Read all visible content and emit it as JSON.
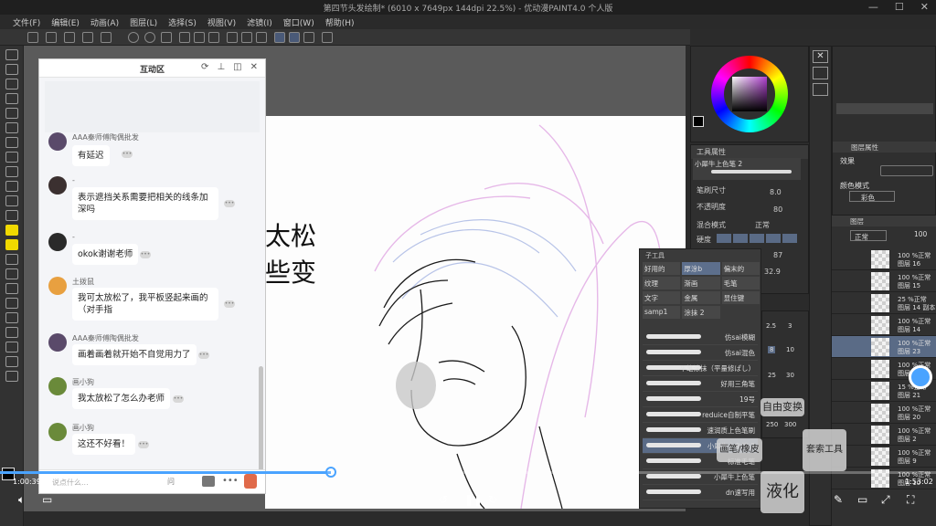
{
  "window": {
    "title": "第四节头发绘制* (6010 x 7649px 144dpi 22.5%) - 优动漫PAINT4.0 个人版",
    "controls": [
      "—",
      "☐",
      "✕"
    ]
  },
  "menu": [
    "文件(F)",
    "编辑(E)",
    "动画(A)",
    "图层(L)",
    "选择(S)",
    "视图(V)",
    "滤镜(I)",
    "窗口(W)",
    "帮助(H)"
  ],
  "chat": {
    "title": "互动区",
    "icons": [
      "⟳",
      "⊥",
      "◫",
      "✕"
    ],
    "input_placeholder": "说点什么...",
    "ask_label": "问",
    "messages": [
      {
        "user": "AAA秦师傅陶偶批发",
        "text": "有延迟",
        "avatar_color": "#5a4a6a"
      },
      {
        "user": "-",
        "text": "表示遮挡关系需要把相关的线条加深吗",
        "avatar_color": "#3b3030"
      },
      {
        "user": "-",
        "text": "okok谢谢老师",
        "avatar_color": "#2a2a2a"
      },
      {
        "user": "土拨鼠",
        "text": "我可太放松了，我平板竖起来画的（对手指",
        "avatar_color": "#e8a040"
      },
      {
        "user": "AAA秦师傅陶偶批发",
        "text": "画着画着就开始不自觉用力了",
        "avatar_color": "#5a4a6a"
      },
      {
        "user": "画小狗",
        "text": "我太放松了怎么办老师",
        "avatar_color": "#6a8a3a"
      },
      {
        "user": "画小狗",
        "text": "这还不好看！",
        "avatar_color": "#6a8a3a"
      }
    ]
  },
  "canvas": {
    "handwriting": [
      "太松",
      "些变"
    ]
  },
  "tool_property": {
    "title": "工具属性",
    "brush_name": "小犀牛上色笔 2",
    "brush_size_label": "笔刷尺寸",
    "brush_size_value": "8.0",
    "opacity_label": "不透明度",
    "opacity_value": "80",
    "blend_label": "混合模式",
    "blend_value": "正常",
    "hardness_label": "硬度",
    "density_label": "浓度",
    "density_value": "87",
    "stabilize_value": "32.9"
  },
  "sub_tool": {
    "title": "子工具",
    "groups": [
      "好用的",
      "厚涂b",
      "偏末的",
      "纹理",
      "渐画",
      "毛笔",
      "文字",
      "金属",
      "显住键",
      "samp1",
      "涂抹 2"
    ],
    "selected_group": "厚涂b",
    "brushes": [
      "仿sai模糊",
      "仿sai混色",
      "平笔涂抹（平量修ぱし）",
      "好用三角笔",
      "19号",
      "reduice自制平笔",
      "速润质上色笔刷",
      "小犀牛上色笔 2",
      "标准毛笔",
      "小犀牛上色笔",
      "dn速写用"
    ],
    "selected_brush": "小犀牛上色笔 2"
  },
  "brush_sizes": [
    "2.5",
    "3",
    "8",
    "10",
    "25",
    "30",
    "250",
    "300"
  ],
  "layer_property": {
    "title": "图层属性",
    "effect_label": "效果",
    "color_mode_label": "颜色模式",
    "color_mode_value": "彩色"
  },
  "layers_panel": {
    "title": "图层",
    "blend": "正常",
    "opacity": "100",
    "layers": [
      {
        "pct": "100 %正常",
        "name": "图层 16"
      },
      {
        "pct": "100 %正常",
        "name": "图层 15"
      },
      {
        "pct": "25 %正常",
        "name": "图层 14 副本"
      },
      {
        "pct": "100 %正常",
        "name": "图层 14"
      },
      {
        "pct": "100 %正常",
        "name": "图层 23"
      },
      {
        "pct": "100 %正常",
        "name": "图层 22"
      },
      {
        "pct": "15 %正常",
        "name": "图层 21"
      },
      {
        "pct": "100 %正常",
        "name": "图层 20"
      },
      {
        "pct": "100 %正常",
        "name": "图层 2"
      },
      {
        "pct": "100 %正常",
        "name": "图层 9"
      },
      {
        "pct": "100 %正常",
        "name": "图层 10"
      }
    ]
  },
  "overlays": {
    "free_transform": "自由变换",
    "brush_tool": "画笔/橡皮",
    "lasso_tool": "套索工具",
    "liquify": "液化"
  },
  "video": {
    "elapsed": "1:00:39",
    "total": "1:53:02",
    "progress": 0.354
  },
  "status": {
    "zoom": "22.5",
    "angle": "0.0"
  }
}
